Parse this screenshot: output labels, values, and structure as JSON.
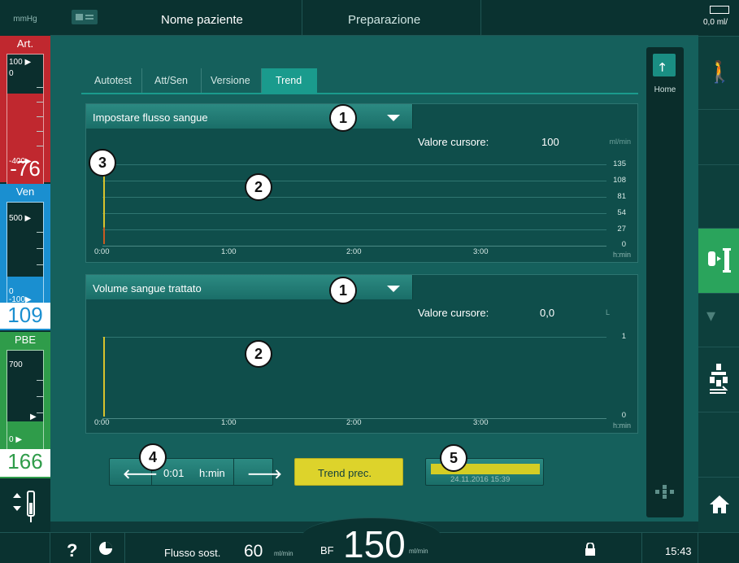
{
  "topbar": {
    "patient_name": "Nome paziente",
    "phase": "Preparazione"
  },
  "left": {
    "unit": "mmHg",
    "art": {
      "title": "Art.",
      "upper": "100",
      "zero": "0",
      "lower": "-400",
      "value": "-76",
      "color": "#c0282f"
    },
    "ven": {
      "title": "Ven",
      "upper": "500",
      "zero": "0",
      "lower": "-100",
      "value": "109",
      "color": "#1a8fd0"
    },
    "pbe": {
      "title": "PBE",
      "upper": "700",
      "zero": "0",
      "value": "166",
      "color": "#2f9c4a"
    }
  },
  "tabs": [
    {
      "label": "Autotest"
    },
    {
      "label": "Att/Sen"
    },
    {
      "label": "Versione"
    },
    {
      "label": "Trend",
      "active": true
    }
  ],
  "home": {
    "label": "Home"
  },
  "trend1": {
    "dropdown": "Impostare flusso sangue",
    "cursor_label": "Valore cursore:",
    "cursor_value": "100",
    "unit": "ml/min",
    "y_ticks": [
      "135",
      "108",
      "81",
      "54",
      "27",
      "0"
    ],
    "x_ticks": [
      "0:00",
      "1:00",
      "2:00",
      "3:00"
    ],
    "x_unit": "h:min"
  },
  "trend2": {
    "dropdown": "Volume sangue trattato",
    "cursor_label": "Valore cursore:",
    "cursor_value": "0,0",
    "unit": "L",
    "y_ticks": [
      "1",
      "0"
    ],
    "x_ticks": [
      "0:00",
      "1:00",
      "2:00",
      "3:00"
    ],
    "x_unit": "h:min"
  },
  "controls": {
    "time_value": "0:01",
    "time_unit": "h:min",
    "prev_trend": "Trend prec.",
    "scroll_date": "24.11.2016 15:39"
  },
  "right": {
    "battery_value": "0,0",
    "battery_unit": "ml/"
  },
  "status": {
    "help": "?",
    "flow_label": "Flusso sost.",
    "flow_value": "60",
    "flow_unit": "ml/min",
    "bf_label": "BF",
    "bf_value": "150",
    "bf_unit": "ml/min",
    "time": "15:43"
  },
  "callouts": [
    "1",
    "2",
    "3",
    "1",
    "2",
    "4",
    "5"
  ],
  "colors": {
    "accent": "#1a9b8d",
    "yellow": "#ddd32b",
    "art_red": "#c0282f",
    "ven_blue": "#1a8fd0",
    "pbe_green": "#2f9c4a"
  }
}
